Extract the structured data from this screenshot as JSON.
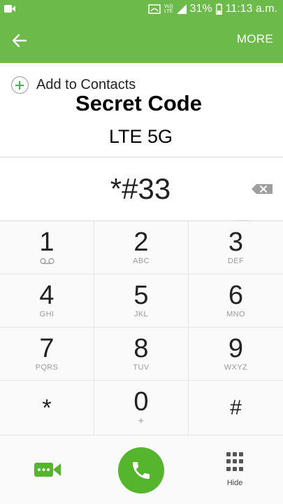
{
  "status_bar": {
    "volte_line1": "Vo))",
    "volte_line2": "LTE",
    "battery_percent": "31%",
    "time": "11:13 a.m."
  },
  "app_bar": {
    "more_label": "MORE"
  },
  "contact": {
    "add_label": "Add to Contacts",
    "title": "Secret Code",
    "subtitle": "LTE 5G"
  },
  "dial": {
    "number": "*#33"
  },
  "keypad": {
    "keys": [
      {
        "digit": "1",
        "letters": ""
      },
      {
        "digit": "2",
        "letters": "ABC"
      },
      {
        "digit": "3",
        "letters": "DEF"
      },
      {
        "digit": "4",
        "letters": "GHI"
      },
      {
        "digit": "5",
        "letters": "JKL"
      },
      {
        "digit": "6",
        "letters": "MNO"
      },
      {
        "digit": "7",
        "letters": "PQRS"
      },
      {
        "digit": "8",
        "letters": "TUV"
      },
      {
        "digit": "9",
        "letters": "WXYZ"
      },
      {
        "digit": "*",
        "letters": ""
      },
      {
        "digit": "0",
        "letters": "+"
      },
      {
        "digit": "#",
        "letters": ""
      }
    ]
  },
  "bottom": {
    "hide_label": "Hide"
  },
  "colors": {
    "brand_green": "#6cba4a",
    "call_green": "#55b52c"
  },
  "icons": [
    "notification-icon",
    "wifi-icon",
    "signal-icon",
    "battery-icon",
    "back-arrow-icon",
    "add-icon",
    "backspace-icon",
    "voicemail-icon",
    "video-call-icon",
    "phone-icon",
    "keypad-grid-icon"
  ]
}
